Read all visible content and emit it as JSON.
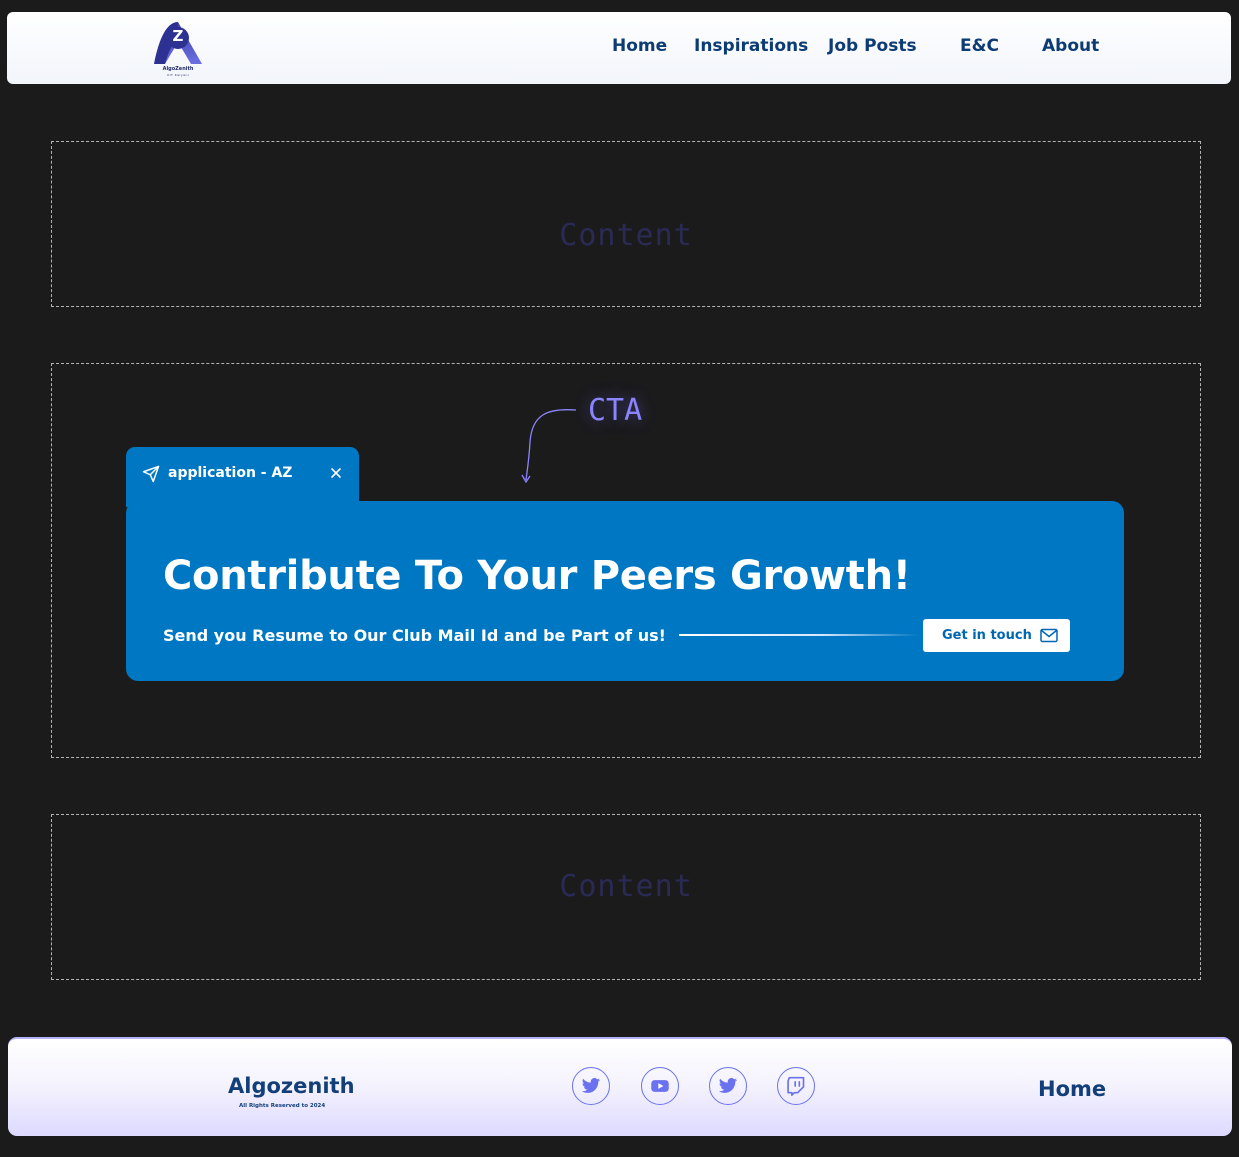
{
  "header": {
    "logo": {
      "letter": "Z",
      "name": "AlgoZenith",
      "sub": "IIIT Kalyani"
    },
    "nav": [
      "Home",
      "Inspirations",
      "Job Posts",
      "E&C",
      "About"
    ]
  },
  "sections": {
    "top_placeholder": "Content",
    "cta_label": "CTA",
    "bottom_placeholder": "Content"
  },
  "cta": {
    "tab_title": "application - AZ",
    "title": "Contribute To Your Peers Growth!",
    "subtitle": "Send you Resume to Our Club Mail Id and be Part of us!",
    "button_label": "Get in touch"
  },
  "footer": {
    "brand": "Algozenith",
    "copyright": "All Rights Reserved to 2024",
    "social_icons": [
      "twitter-icon",
      "youtube-icon",
      "twitter-icon",
      "twitch-icon"
    ],
    "home_link": "Home"
  },
  "colors": {
    "background": "#1b1b1c",
    "card": "#0077c2",
    "nav_text": "#0d3b73",
    "cta_label": "#8c84ff",
    "social_border": "#6b72f0"
  }
}
